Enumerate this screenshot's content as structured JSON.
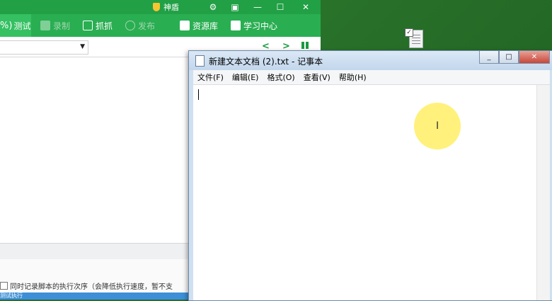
{
  "app": {
    "badge_label": "神盾",
    "toolbar": {
      "test_percent": "%)",
      "test_label": "测试",
      "record_label": "录制",
      "capture_label": "抓抓",
      "publish_label": "发布",
      "resources_label": "资源库",
      "learn_label": "学习中心"
    },
    "nav_prev": "<",
    "nav_next": ">",
    "record_order_label": "同时记录脚本的执行次序（会降低执行速度，暂不支",
    "status_text": "测试执行"
  },
  "notepad": {
    "title": "新建文本文档 (2).txt - 记事本",
    "menus": [
      "文件(F)",
      "编辑(E)",
      "格式(O)",
      "查看(V)",
      "帮助(H)"
    ],
    "content": ""
  },
  "colors": {
    "app_green": "#2aae52",
    "desktop_green": "#2f7f2f",
    "cursor_highlight": "#ffee5a"
  }
}
